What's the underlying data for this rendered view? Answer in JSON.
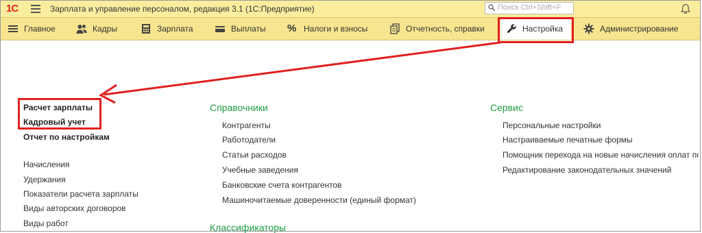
{
  "app": {
    "logo_text": "1С",
    "title": "Зарплата и управление персоналом, редакция 3.1  (1С:Предприятие)",
    "search_placeholder": "Поиск Ctrl+Shift+F"
  },
  "menu": [
    {
      "label": "Главное",
      "icon": "menu-lines-icon"
    },
    {
      "label": "Кадры",
      "icon": "people-icon"
    },
    {
      "label": "Зарплата",
      "icon": "calculator-icon"
    },
    {
      "label": "Выплаты",
      "icon": "wallet-icon"
    },
    {
      "label": "Налоги и взносы",
      "icon": "percent-icon"
    },
    {
      "label": "Отчетность, справки",
      "icon": "documents-icon"
    },
    {
      "label": "Настройка",
      "icon": "wrench-icon"
    },
    {
      "label": "Администрирование",
      "icon": "gear-icon"
    }
  ],
  "col1": {
    "bold_links": [
      "Расчет зарплаты",
      "Кадровый учет",
      "Отчет по настройкам"
    ],
    "links": [
      "Начисления",
      "Удержания",
      "Показатели расчета зарплаты",
      "Виды авторских договоров",
      "Виды работ"
    ]
  },
  "col2": {
    "section_title": "Справочники",
    "links": [
      "Контрагенты",
      "Работодатели",
      "Статьи расходов",
      "Учебные заведения",
      "Банковские счета контрагентов",
      "Машиночитаемые доверенности (единый формат)"
    ],
    "section2_title": "Классификаторы"
  },
  "col3": {
    "section_title": "Сервис",
    "links": [
      "Персональные настройки",
      "Настраиваемые печатные формы",
      "Помощник перехода на новые начисления оплат по",
      "Редактирование законодательных значений"
    ]
  },
  "colors": {
    "accent": "#1e9b45",
    "highlight": "#e02020",
    "menubar": "#f7e58f"
  }
}
